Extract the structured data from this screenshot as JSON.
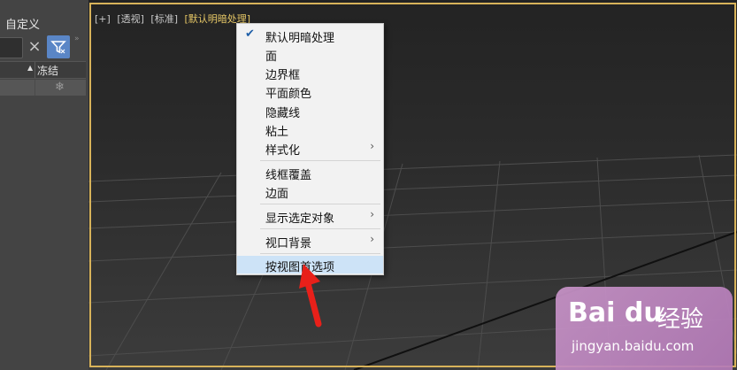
{
  "left_panel": {
    "title": "自定义",
    "clear_icon": "×",
    "filter_icon": "filter-icon",
    "collapse_icon": "»",
    "column_header": "冻结",
    "sort_arrow": "▲",
    "freeze_icon": "❄"
  },
  "viewport": {
    "labels": [
      "[+]",
      "[透视]",
      "[标准]",
      "[默认明暗处理]"
    ],
    "border_color": "#d8b35a",
    "active_label_color": "#e6c766"
  },
  "context_menu": {
    "items": [
      {
        "label": "默认明暗处理",
        "checked": true
      },
      {
        "label": "面"
      },
      {
        "label": "边界框"
      },
      {
        "label": "平面颜色"
      },
      {
        "label": "隐藏线"
      },
      {
        "label": "粘土"
      },
      {
        "label": "样式化",
        "submenu": true
      },
      {
        "label": "线框覆盖"
      },
      {
        "label": "边面"
      },
      {
        "label": "显示选定对象",
        "submenu": true
      },
      {
        "label": "视口背景",
        "submenu": true
      },
      {
        "label": "按视图首选项",
        "highlighted": true
      }
    ],
    "check_glyph": "✔",
    "submenu_glyph": "›",
    "highlight_color": "#cde3f7"
  },
  "annotation": {
    "arrow_color": "#e8201a"
  },
  "watermark": {
    "logo": "Bai du",
    "brand": "经验",
    "url": "jingyan.baidu.com"
  }
}
